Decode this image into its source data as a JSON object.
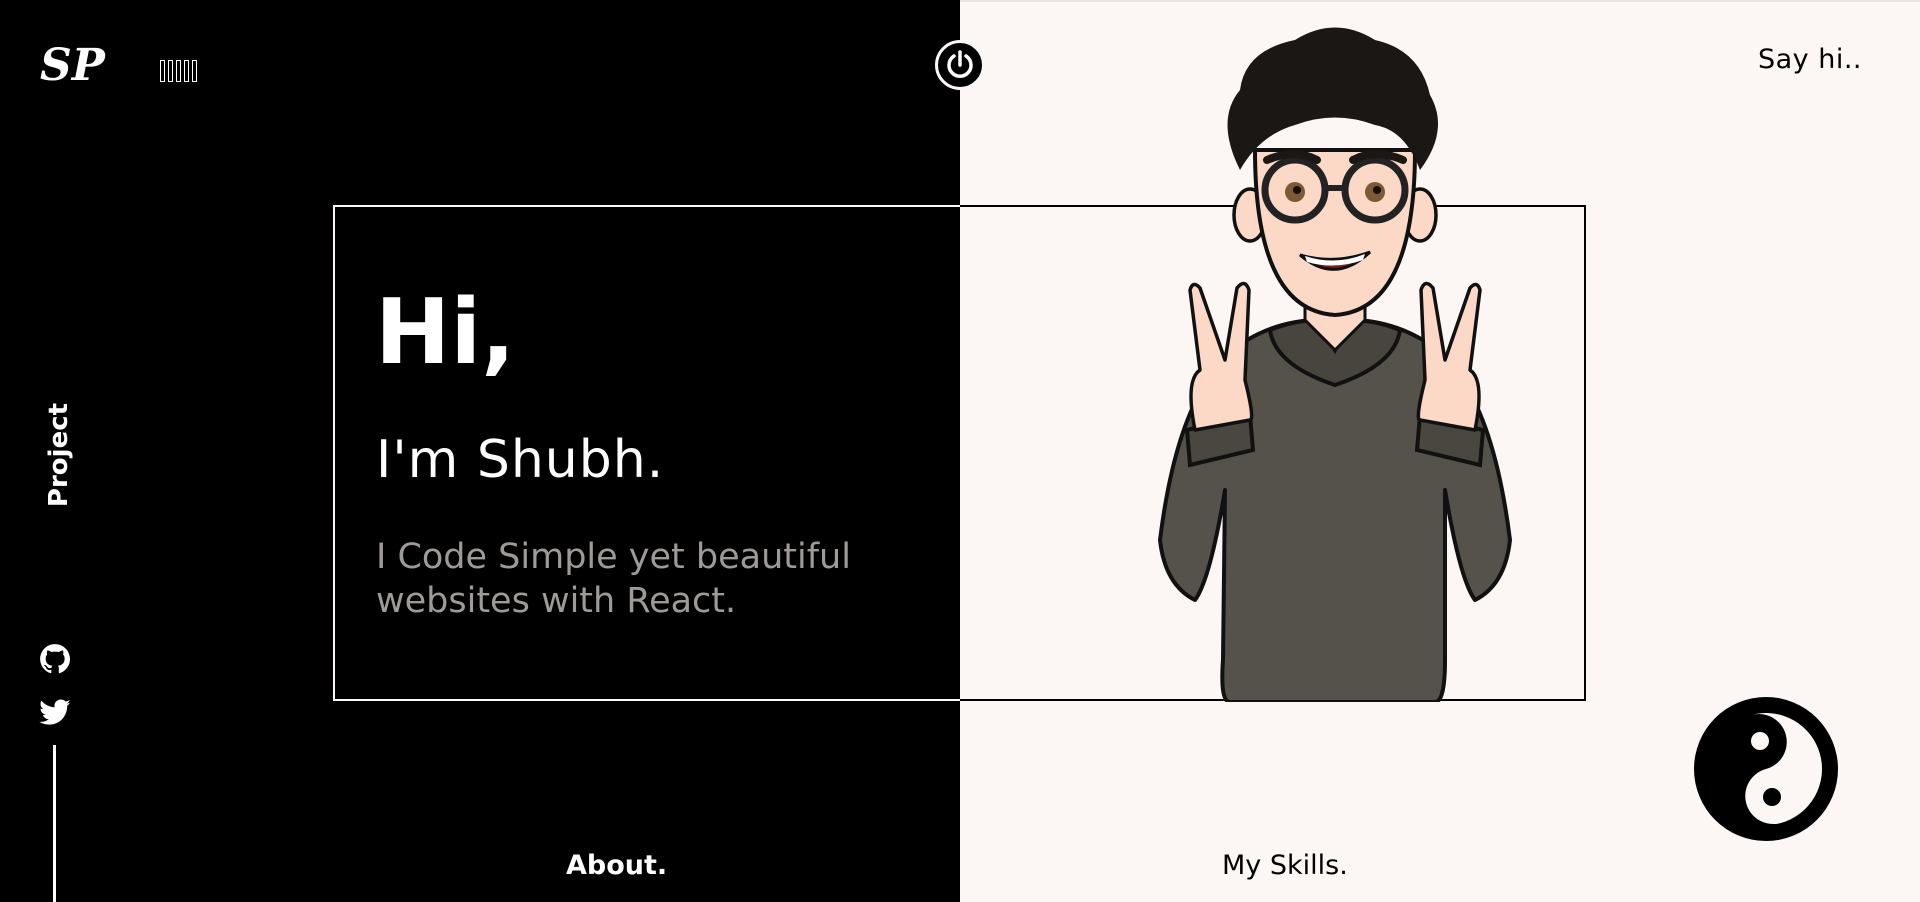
{
  "logo": {
    "text": "SP"
  },
  "music_toggle": {
    "icon": "sound-bars-icon",
    "bars": 5
  },
  "power_button": {
    "icon": "power-icon"
  },
  "nav": {
    "say_hi": "Say hi..",
    "project": "Project",
    "about": "About.",
    "skills": "My Skills."
  },
  "hero": {
    "greeting": "Hi,",
    "name": "I'm Shubh.",
    "tagline": "I Code Simple yet beautiful websites with React."
  },
  "social": [
    {
      "icon": "github-icon"
    },
    {
      "icon": "twitter-icon"
    }
  ],
  "theme_toggle": {
    "icon": "yin-yang-icon"
  },
  "colors": {
    "dark": "#000000",
    "light": "#fcf6f4",
    "muted_text": "#9e9a98"
  }
}
